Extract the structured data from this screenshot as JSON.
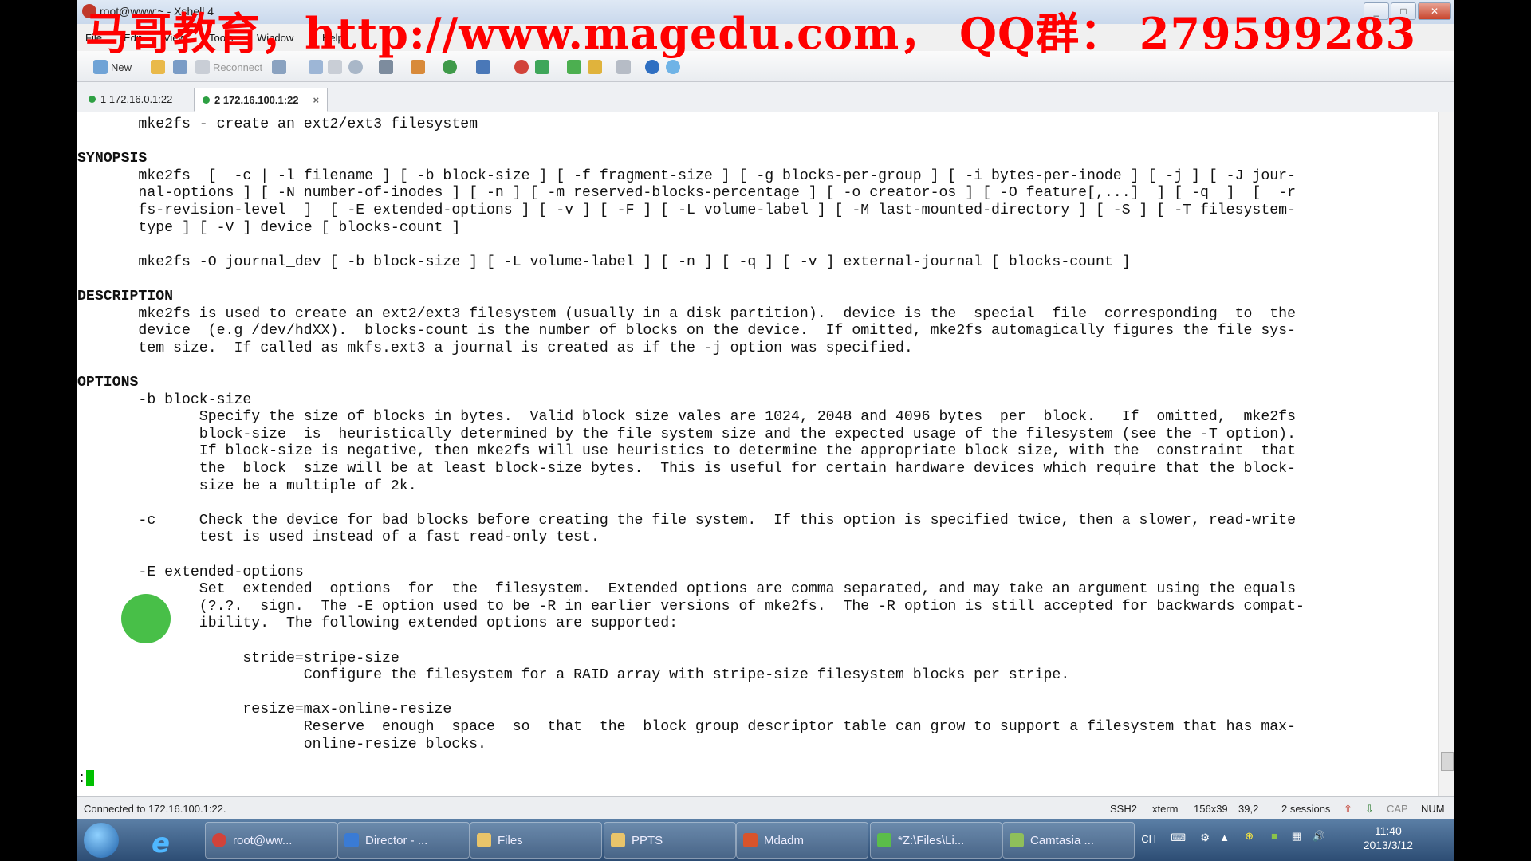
{
  "window": {
    "title": "root@www:~ - Xshell 4",
    "controls": [
      "_",
      "□",
      "✕"
    ]
  },
  "watermark": "马哥教育，http://www.magedu.com， QQ群： 279599283",
  "menu": [
    "File",
    "Edit",
    "View",
    "Tools",
    "Window",
    "Help"
  ],
  "toolbar": {
    "new_label": "New",
    "reconnect_label": "Reconnect"
  },
  "tabs": [
    {
      "label": "1 172.16.0.1:22",
      "active": false
    },
    {
      "label": "2 172.16.100.1:22",
      "active": true,
      "close": "×"
    }
  ],
  "terminal_lines": [
    "       mke2fs - create an ext2/ext3 filesystem",
    "",
    "SYNOPSIS",
    "       mke2fs  [  -c | -l filename ] [ -b block-size ] [ -f fragment-size ] [ -g blocks-per-group ] [ -i bytes-per-inode ] [ -j ] [ -J jour-",
    "       nal-options ] [ -N number-of-inodes ] [ -n ] [ -m reserved-blocks-percentage ] [ -o creator-os ] [ -O feature[,...]  ] [ -q  ]  [  -r",
    "       fs-revision-level  ]  [ -E extended-options ] [ -v ] [ -F ] [ -L volume-label ] [ -M last-mounted-directory ] [ -S ] [ -T filesystem-",
    "       type ] [ -V ] device [ blocks-count ]",
    "",
    "       mke2fs -O journal_dev [ -b block-size ] [ -L volume-label ] [ -n ] [ -q ] [ -v ] external-journal [ blocks-count ]",
    "",
    "DESCRIPTION",
    "       mke2fs is used to create an ext2/ext3 filesystem (usually in a disk partition).  device is the  special  file  corresponding  to  the",
    "       device  (e.g /dev/hdXX).  blocks-count is the number of blocks on the device.  If omitted, mke2fs automagically figures the file sys-",
    "       tem size.  If called as mkfs.ext3 a journal is created as if the -j option was specified.",
    "",
    "OPTIONS",
    "       -b block-size",
    "              Specify the size of blocks in bytes.  Valid block size vales are 1024, 2048 and 4096 bytes  per  block.   If  omitted,  mke2fs",
    "              block-size  is  heuristically determined by the file system size and the expected usage of the filesystem (see the -T option).",
    "              If block-size is negative, then mke2fs will use heuristics to determine the appropriate block size, with the  constraint  that",
    "              the  block  size will be at least block-size bytes.  This is useful for certain hardware devices which require that the block-",
    "              size be a multiple of 2k.",
    "",
    "       -c     Check the device for bad blocks before creating the file system.  If this option is specified twice, then a slower, read-write",
    "              test is used instead of a fast read-only test.",
    "",
    "       -E extended-options",
    "              Set  extended  options  for  the  filesystem.  Extended options are comma separated, and may take an argument using the equals",
    "              (?.?.  sign.  The -E option used to be -R in earlier versions of mke2fs.  The -R option is still accepted for backwards compat-",
    "              ibility.  The following extended options are supported:",
    "",
    "                   stride=stripe-size",
    "                          Configure the filesystem for a RAID array with stripe-size filesystem blocks per stripe.",
    "",
    "                   resize=max-online-resize",
    "                          Reserve  enough  space  so  that  the  block group descriptor table can grow to support a filesystem that has max-",
    "                          online-resize blocks.",
    "",
    ":"
  ],
  "status": {
    "connection": "Connected to 172.16.100.1:22.",
    "protocol": "SSH2",
    "term": "xterm",
    "size": "156x39",
    "pos": "39,2",
    "sessions": "2 sessions",
    "cap": "CAP",
    "num": "NUM"
  },
  "taskbar": {
    "items": [
      "root@ww...",
      "Director - ...",
      "Files",
      "PPTS",
      "Mdadm",
      "*Z:\\Files\\Li...",
      "Camtasia ..."
    ],
    "lang": "CH",
    "time": "11:40",
    "date": "2013/3/12"
  }
}
